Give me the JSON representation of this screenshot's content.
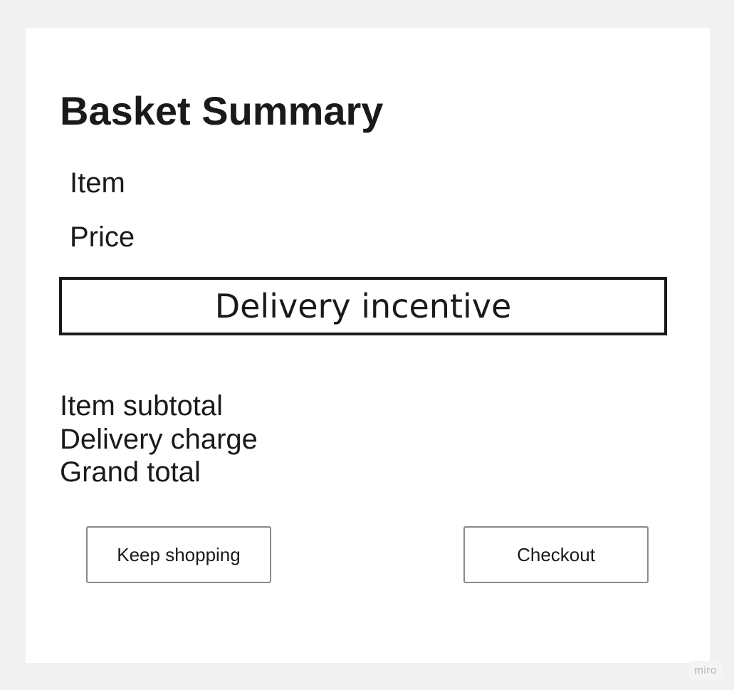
{
  "card": {
    "title": "Basket Summary",
    "fields": {
      "item_label": "Item",
      "price_label": "Price"
    },
    "incentive": {
      "label": "Delivery incentive"
    },
    "totals": {
      "subtotal_label": "Item subtotal",
      "delivery_label": "Delivery charge",
      "grand_total_label": "Grand total"
    },
    "actions": {
      "keep_shopping_label": "Keep shopping",
      "checkout_label": "Checkout"
    }
  },
  "watermark": {
    "text": "miro"
  },
  "colors": {
    "background": "#f1f1f1",
    "card": "#ffffff",
    "text": "#1a1a1a",
    "button_border": "#8a8a8a"
  }
}
